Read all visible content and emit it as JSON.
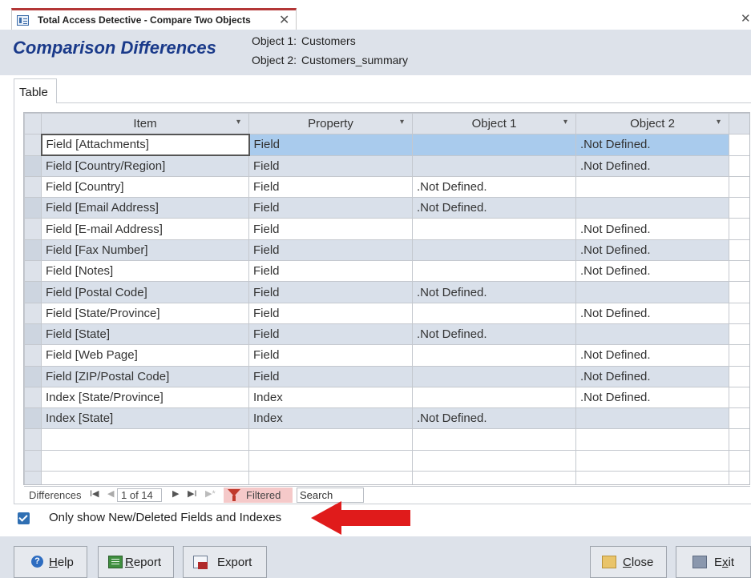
{
  "window": {
    "tab_title": "Total Access Detective - Compare Two Objects",
    "tab_close_glyph": "✕",
    "window_close_glyph": "✕",
    "tab_icon": "form-icon"
  },
  "header": {
    "title": "Comparison Differences",
    "object1_label": "Object 1:",
    "object1_value": "Customers",
    "object2_label": "Object 2:",
    "object2_value": "Customers_summary"
  },
  "form_tab": {
    "label": "Table"
  },
  "grid": {
    "columns": [
      "Item",
      "Property",
      "Object 1",
      "Object 2"
    ],
    "dropdown_glyph": "▾",
    "rows": [
      {
        "item": "Field [Attachments]",
        "property": "Field",
        "object1": "",
        "object2": ".Not Defined."
      },
      {
        "item": "Field [Country/Region]",
        "property": "Field",
        "object1": "",
        "object2": ".Not Defined."
      },
      {
        "item": "Field [Country]",
        "property": "Field",
        "object1": ".Not Defined.",
        "object2": ""
      },
      {
        "item": "Field [Email Address]",
        "property": "Field",
        "object1": ".Not Defined.",
        "object2": ""
      },
      {
        "item": "Field [E-mail Address]",
        "property": "Field",
        "object1": "",
        "object2": ".Not Defined."
      },
      {
        "item": "Field [Fax Number]",
        "property": "Field",
        "object1": "",
        "object2": ".Not Defined."
      },
      {
        "item": "Field [Notes]",
        "property": "Field",
        "object1": "",
        "object2": ".Not Defined."
      },
      {
        "item": "Field [Postal Code]",
        "property": "Field",
        "object1": ".Not Defined.",
        "object2": ""
      },
      {
        "item": "Field [State/Province]",
        "property": "Field",
        "object1": "",
        "object2": ".Not Defined."
      },
      {
        "item": "Field [State]",
        "property": "Field",
        "object1": ".Not Defined.",
        "object2": ""
      },
      {
        "item": "Field [Web Page]",
        "property": "Field",
        "object1": "",
        "object2": ".Not Defined."
      },
      {
        "item": "Field [ZIP/Postal Code]",
        "property": "Field",
        "object1": "",
        "object2": ".Not Defined."
      },
      {
        "item": "Index [State/Province]",
        "property": "Index",
        "object1": "",
        "object2": ".Not Defined."
      },
      {
        "item": "Index [State]",
        "property": "Index",
        "object1": ".Not Defined.",
        "object2": ""
      }
    ]
  },
  "navigation": {
    "label": "Differences",
    "first_glyph": "I◀",
    "prev_glyph": "◀",
    "record": "1 of 14",
    "next_glyph": "▶",
    "last_glyph": "▶I",
    "new_glyph": "▶*",
    "filter_label": "Filtered",
    "search_placeholder": "Search"
  },
  "options": {
    "only_new_deleted_label": "Only show New/Deleted Fields and Indexes",
    "only_new_deleted_checked": true
  },
  "buttons": {
    "help": {
      "prefix": "",
      "accel": "H",
      "rest": "elp"
    },
    "report": {
      "prefix": "",
      "accel": "R",
      "rest": "eport"
    },
    "export": {
      "prefix": "",
      "accel": "",
      "rest": "Export"
    },
    "close": {
      "prefix": "",
      "accel": "C",
      "rest": "lose"
    },
    "exit": {
      "prefix": "E",
      "accel": "x",
      "rest": "it"
    }
  },
  "colors": {
    "accent_red": "#e01b1b",
    "title_blue": "#1a3a8a",
    "header_band": "#dde2ea",
    "selection_blue": "#a9cbed"
  }
}
